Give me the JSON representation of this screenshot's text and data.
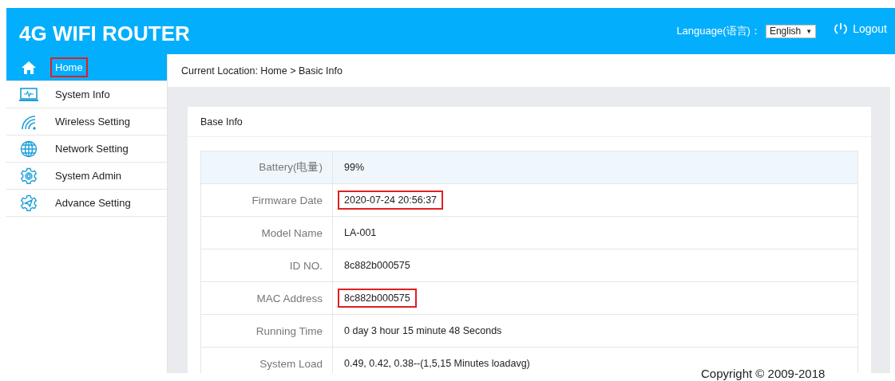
{
  "header": {
    "title": "4G WIFI ROUTER",
    "language_label": "Language(语言)：",
    "language_value": "English",
    "language_caret": "▼",
    "logout": "Logout"
  },
  "sidebar": {
    "items": [
      {
        "label": "Home",
        "selected": true,
        "highlighted": true
      },
      {
        "label": "System Info",
        "selected": false,
        "highlighted": false
      },
      {
        "label": "Wireless Setting",
        "selected": false,
        "highlighted": false
      },
      {
        "label": "Network Setting",
        "selected": false,
        "highlighted": false
      },
      {
        "label": "System Admin",
        "selected": false,
        "highlighted": false
      },
      {
        "label": "Advance Setting",
        "selected": false,
        "highlighted": false
      }
    ]
  },
  "breadcrumb": "Current Location: Home > Basic Info",
  "panel": {
    "title": "Base Info",
    "rows": [
      {
        "label": "Battery(电量)",
        "value": "99%",
        "highlighted": false
      },
      {
        "label": "Firmware Date",
        "value": "2020-07-24 20:56:37",
        "highlighted": true
      },
      {
        "label": "Model Name",
        "value": "LA-001",
        "highlighted": false
      },
      {
        "label": "ID NO.",
        "value": "8c882b000575",
        "highlighted": false
      },
      {
        "label": "MAC Address",
        "value": "8c882b000575",
        "highlighted": true
      },
      {
        "label": "Running Time",
        "value": "0 day 3 hour 15 minute 48 Seconds",
        "highlighted": false
      },
      {
        "label": "System Load",
        "value": "0.49, 0.42, 0.38--(1,5,15 Minutes loadavg)",
        "highlighted": false
      }
    ]
  },
  "footer": "Copyright © 2009-2018"
}
